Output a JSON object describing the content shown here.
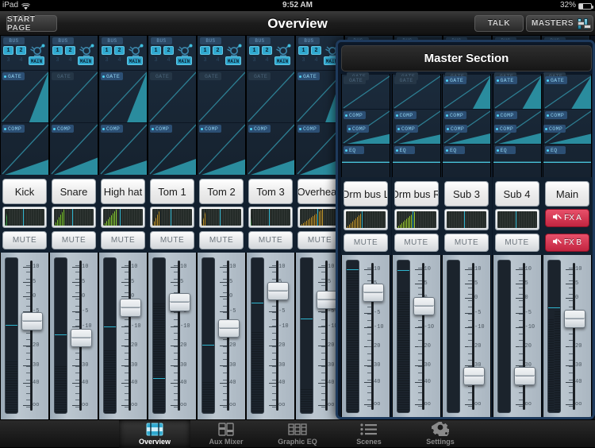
{
  "status_bar": {
    "carrier": "iPad",
    "wifi_icon": "wifi-icon",
    "time": "9:52 AM",
    "battery_percent": "32%",
    "battery_level": 32
  },
  "nav_bar": {
    "start_page_label": "START PAGE",
    "title": "Overview",
    "talk_label": "TALK",
    "masters_label": "MASTERS",
    "masters_icon": "fader-icon"
  },
  "colors": {
    "accent_cyan": "#2fa8cf",
    "meter_blue": "#19b5e6",
    "teal_curve": "#2a8c9e",
    "fx_red": "#c22540",
    "panel_blue": "#1e3a5c"
  },
  "fader_scale": {
    "labels": [
      "10",
      "5",
      "0",
      "-5",
      "-10",
      "20",
      "30",
      "40",
      "oo"
    ]
  },
  "channel_common": {
    "bus_label": "BUS",
    "bus_buttons": [
      "1",
      "2",
      "3",
      "4"
    ],
    "main_label": "MAIN",
    "gate_label": "GATE",
    "comp_label": "COMP",
    "eq_label": "EQ",
    "mute_label": "MUTE",
    "pan_icon": "pan-knob-icon"
  },
  "channels": [
    {
      "name": "Kick",
      "gate_on": true,
      "comp_on": true,
      "eq_on": true,
      "bus": [
        true,
        true,
        false,
        false
      ],
      "main_on": true,
      "eq_shape": "flat",
      "gate_area": 78,
      "comp_area": 55,
      "meter": {
        "level": 8,
        "peak": null,
        "tick": 45,
        "color": "#3fa34d"
      },
      "fader_pos": 0.4,
      "level_meter": 0.33,
      "mark": 0.56
    },
    {
      "name": "Snare",
      "gate_on": false,
      "comp_on": true,
      "eq_on": true,
      "bus": [
        true,
        true,
        false,
        false
      ],
      "main_on": true,
      "eq_shape": "shelf_lo_cut",
      "gate_area": 0,
      "comp_area": 62,
      "meter": {
        "level": 26,
        "peak": 42,
        "tick": 45,
        "color": "#7ec832"
      },
      "fader_pos": 0.52,
      "level_meter": 0.3,
      "mark": 0.5
    },
    {
      "name": "High hat",
      "gate_on": true,
      "comp_on": true,
      "eq_on": true,
      "bus": [
        true,
        true,
        false,
        false
      ],
      "main_on": true,
      "eq_shape": "flat",
      "gate_area": 80,
      "comp_area": 52,
      "meter": {
        "level": 34,
        "peak": 54,
        "tick": 42,
        "color": "#8ed33a"
      },
      "fader_pos": 0.3,
      "level_meter": 0.4,
      "mark": 0.55
    },
    {
      "name": "Tom 1",
      "gate_on": false,
      "comp_on": true,
      "eq_on": true,
      "bus": [
        true,
        true,
        false,
        false
      ],
      "main_on": true,
      "eq_shape": "notch",
      "gate_area": 0,
      "comp_area": 58,
      "meter": {
        "level": 20,
        "peak": 30,
        "tick": 46,
        "color": "#c79a2e"
      },
      "fader_pos": 0.26,
      "level_meter": 0.7,
      "mark": 0.22
    },
    {
      "name": "Tom 2",
      "gate_on": false,
      "comp_on": true,
      "eq_on": true,
      "bus": [
        true,
        true,
        false,
        false
      ],
      "main_on": true,
      "eq_shape": "dip_notch",
      "gate_area": 0,
      "comp_area": 56,
      "meter": {
        "level": 12,
        "peak": 18,
        "tick": 45,
        "color": "#c79a2e"
      },
      "fader_pos": 0.45,
      "level_meter": 0.2,
      "mark": 0.43
    },
    {
      "name": "Tom 3",
      "gate_on": false,
      "comp_on": true,
      "eq_on": true,
      "bus": [
        true,
        true,
        false,
        false
      ],
      "main_on": true,
      "eq_shape": "flat",
      "gate_area": 0,
      "comp_area": 54,
      "meter": {
        "level": 4,
        "peak": null,
        "tick": 46,
        "color": "#3fa34d"
      },
      "fader_pos": 0.18,
      "level_meter": 0.52,
      "mark": 0.7
    },
    {
      "name": "Overhead",
      "gate_on": true,
      "comp_on": true,
      "eq_on": true,
      "bus": [
        true,
        true,
        false,
        false
      ],
      "main_on": true,
      "eq_shape": "shelf_hi_cut",
      "gate_area": 74,
      "comp_area": 60,
      "meter": {
        "level": 58,
        "peak": 62,
        "tick": 44,
        "color": "#c79a2e"
      },
      "fader_pos": 0.24,
      "level_meter": 0.15,
      "mark": 0.6
    }
  ],
  "master_section": {
    "title": "Master Section",
    "fx_a_label": "FX A",
    "fx_b_label": "FX B",
    "fx_icon": "speaker-muted-icon",
    "channels": [
      {
        "name": "Drm bus L",
        "gate_on": false,
        "comp_on": true,
        "eq_on": true,
        "gate_area": 0,
        "comp_area": 55,
        "meter": {
          "level": 44,
          "peak": null,
          "tick": 40,
          "color": "#c79a2e"
        },
        "fader_pos": 0.18,
        "level_meter": 0.92,
        "mark": 0.93,
        "stereo": false,
        "has_fx": false
      },
      {
        "name": "Drm bus R",
        "gate_on": false,
        "comp_on": true,
        "eq_on": true,
        "gate_area": 0,
        "comp_area": 52,
        "meter": {
          "level": 48,
          "peak": 58,
          "tick": 40,
          "color": "#9fd136"
        },
        "fader_pos": 0.28,
        "level_meter": 0.78,
        "mark": 0.92,
        "stereo": false,
        "has_fx": false
      },
      {
        "name": "Sub 3",
        "gate_on": true,
        "comp_on": true,
        "eq_on": true,
        "gate_area": 72,
        "comp_area": 58,
        "meter": {
          "level": 0,
          "peak": null,
          "tick": 44,
          "color": "#3fa34d"
        },
        "fader_pos": 0.8,
        "level_meter": 0,
        "mark": null,
        "stereo": false,
        "has_fx": false
      },
      {
        "name": "Sub 4",
        "gate_on": true,
        "comp_on": true,
        "eq_on": true,
        "gate_area": 76,
        "comp_area": 60,
        "meter": {
          "level": 0,
          "peak": null,
          "tick": 46,
          "color": "#3fa34d"
        },
        "fader_pos": 0.8,
        "level_meter": 0,
        "mark": null,
        "stereo": false,
        "has_fx": false
      },
      {
        "name": "Main",
        "gate_on": true,
        "comp_on": true,
        "eq_on": true,
        "gate_area": 80,
        "comp_area": 56,
        "meter": null,
        "fader_pos": 0.37,
        "level_meter": 0.66,
        "mark": 0.68,
        "stereo": true,
        "has_fx": true
      }
    ]
  },
  "tab_bar": {
    "tabs": [
      {
        "label": "Overview",
        "icon": "mixer-icon",
        "selected": true
      },
      {
        "label": "Aux Mixer",
        "icon": "aux-mixer-icon",
        "selected": false
      },
      {
        "label": "Graphic EQ",
        "icon": "graphic-eq-icon",
        "selected": false
      },
      {
        "label": "Scenes",
        "icon": "list-icon",
        "selected": false
      },
      {
        "label": "Settings",
        "icon": "gear-icon",
        "selected": false
      }
    ]
  }
}
